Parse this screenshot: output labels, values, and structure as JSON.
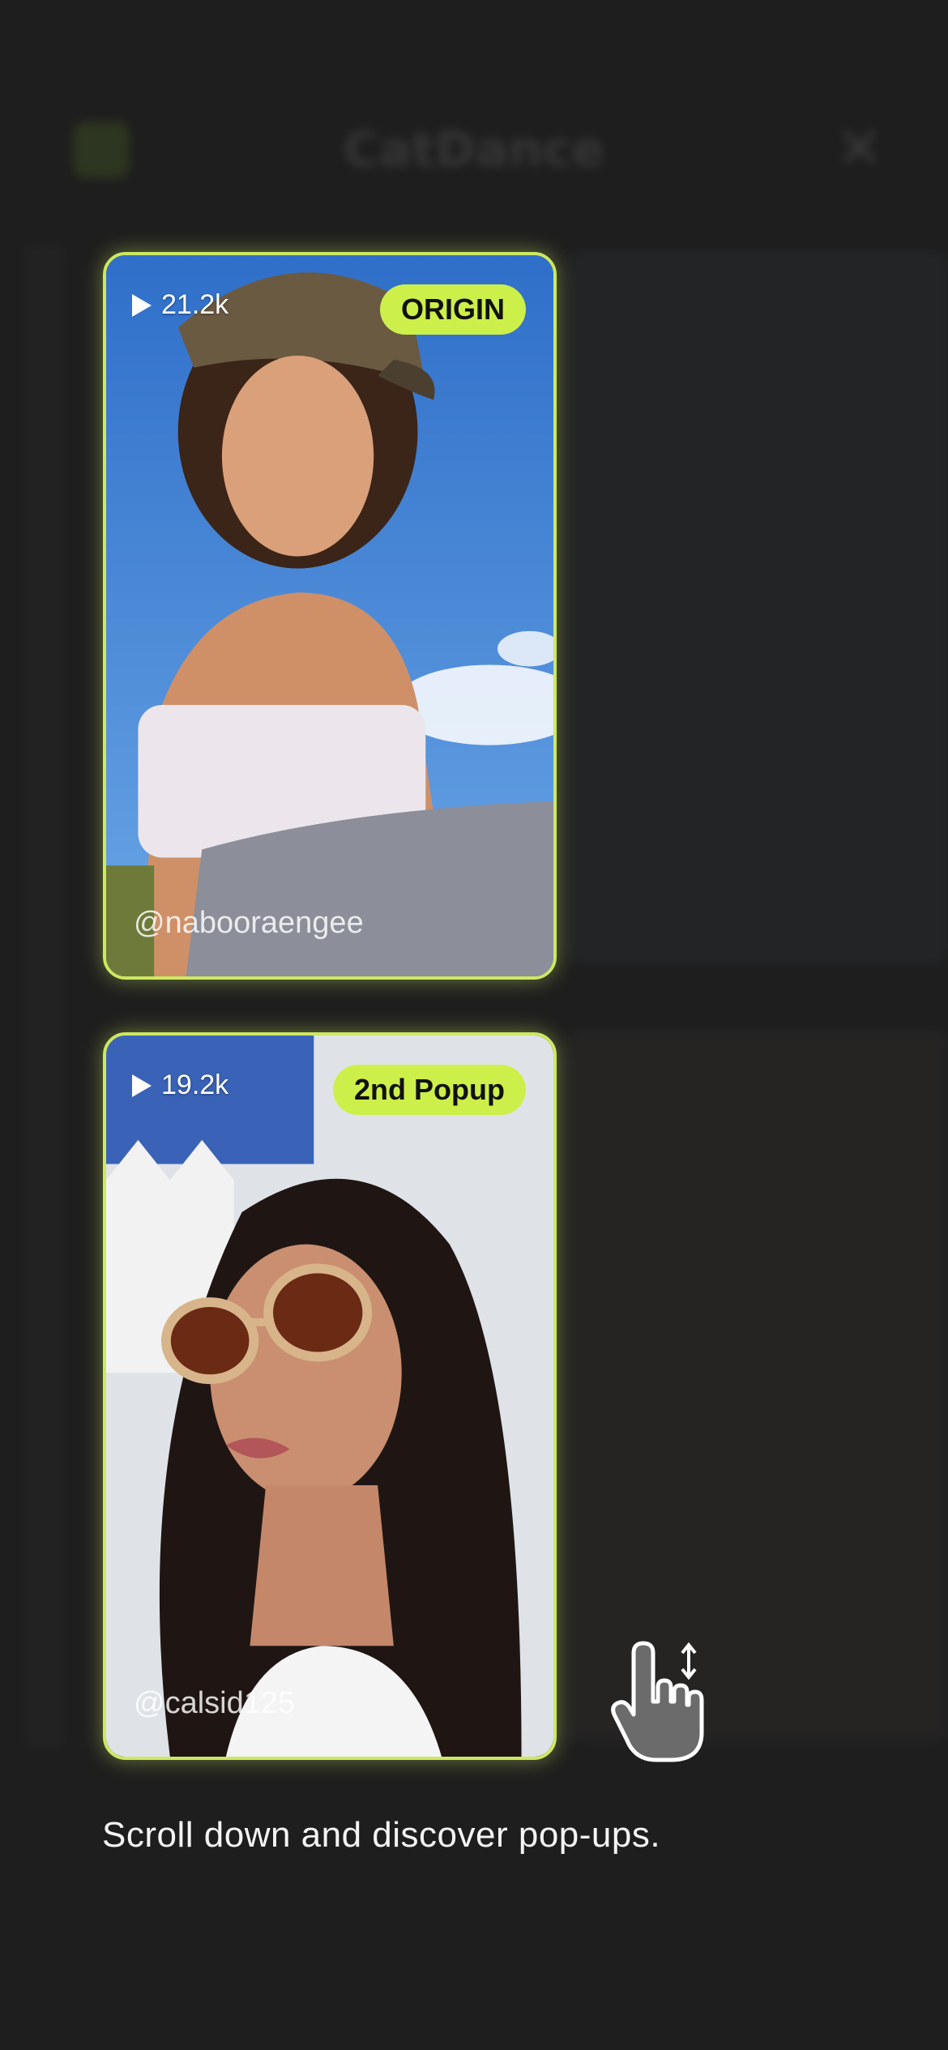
{
  "background": {
    "app_title": "CatDance"
  },
  "cards": [
    {
      "views": "21.2k",
      "badge": "ORIGIN",
      "handle": "@nabooraengee"
    },
    {
      "views": "19.2k",
      "badge": "2nd Popup",
      "handle": "@calsid125"
    }
  ],
  "hint": {
    "text": "Scroll down and discover pop-ups."
  },
  "colors": {
    "accent": "#cdef4a",
    "background": "#1e1e1e"
  },
  "icons": {
    "views": "play-icon",
    "gesture": "swipe-hand-icon",
    "close": "close-icon"
  }
}
